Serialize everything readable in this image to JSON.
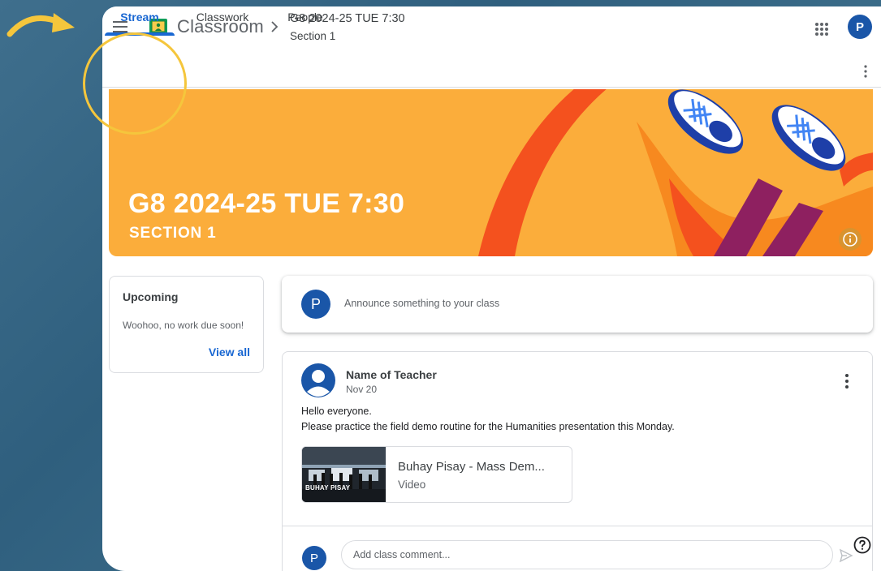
{
  "colors": {
    "accent": "#1967d2",
    "banner": "#fbad3b",
    "avatar": "#1a56a8",
    "highlight": "#f5c63c",
    "background": "#3a6a88"
  },
  "header": {
    "app_name": "Classroom",
    "class_title": "G8 2024-25 TUE 7:30",
    "class_section": "Section 1",
    "avatar_letter": "P",
    "icons": [
      "menu-icon",
      "classroom-logo-icon",
      "chevron-right-icon",
      "apps-grid-icon",
      "more-vert-icon"
    ]
  },
  "tabs": [
    {
      "label": "Stream",
      "active": true
    },
    {
      "label": "Classwork",
      "active": false
    },
    {
      "label": "People",
      "active": false
    }
  ],
  "banner": {
    "title": "G8 2024-25 TUE 7:30",
    "section": "SECTION 1"
  },
  "upcoming": {
    "title": "Upcoming",
    "message": "Woohoo, no work due soon!",
    "view_all": "View all"
  },
  "announce": {
    "avatar_letter": "P",
    "placeholder": "Announce something to your class"
  },
  "post": {
    "author": "Name of Teacher",
    "date": "Nov 20",
    "body_line1": "Hello everyone.",
    "body_line2": "Please practice the field demo routine for the Humanities presentation this Monday.",
    "attachment": {
      "title": "Buhay Pisay - Mass Dem...",
      "type": "Video",
      "thumb_caption": "BUHAY PISAY"
    },
    "comment_avatar_letter": "P",
    "comment_placeholder": "Add class comment..."
  }
}
